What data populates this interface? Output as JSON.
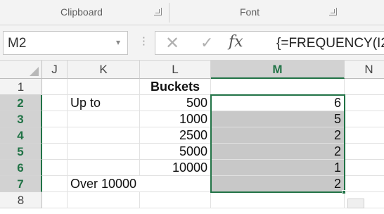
{
  "ribbon": {
    "groups": [
      {
        "label": "Clipboard"
      },
      {
        "label": "Font"
      }
    ]
  },
  "formula_bar": {
    "name_box": "M2",
    "formula": "{=FREQUENCY(I2"
  },
  "columns": [
    "J",
    "K",
    "L",
    "M",
    "N"
  ],
  "rows": [
    {
      "num": "1",
      "K": "",
      "L": "Buckets",
      "M": ""
    },
    {
      "num": "2",
      "K": "Up to",
      "L": "500",
      "M": "6"
    },
    {
      "num": "3",
      "K": "",
      "L": "1000",
      "M": "5"
    },
    {
      "num": "4",
      "K": "",
      "L": "2500",
      "M": "2"
    },
    {
      "num": "5",
      "K": "",
      "L": "5000",
      "M": "2"
    },
    {
      "num": "6",
      "K": "",
      "L": "10000",
      "M": "1"
    },
    {
      "num": "7",
      "K": "Over 10000",
      "L": "",
      "M": "2"
    },
    {
      "num": "8",
      "K": "",
      "L": "",
      "M": ""
    }
  ],
  "selection": {
    "active_cell": "M2",
    "range": "M2:M7"
  },
  "colors": {
    "accent": "#217346",
    "selection_fill": "#c8c8c8",
    "header_bg": "#f3f3f3"
  }
}
